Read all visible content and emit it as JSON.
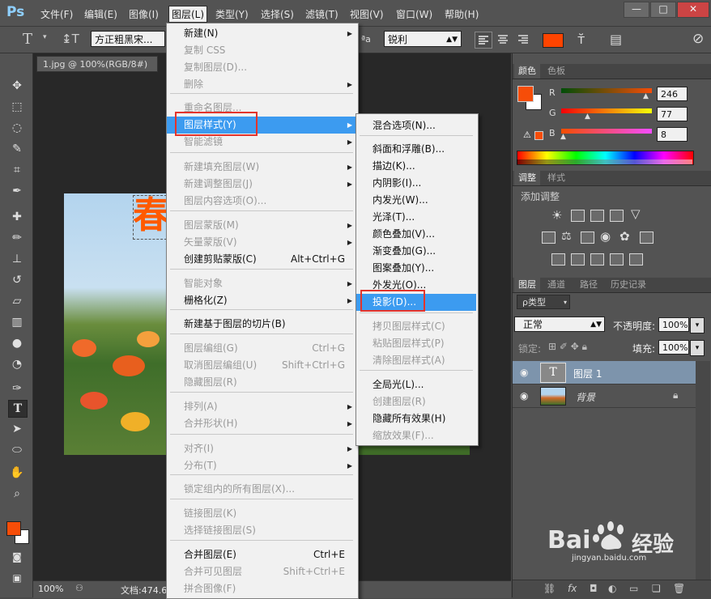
{
  "app": {
    "logo": "Ps",
    "menubar": [
      "文件(F)",
      "编辑(E)",
      "图像(I)",
      "图层(L)",
      "类型(Y)",
      "选择(S)",
      "滤镜(T)",
      "视图(V)",
      "窗口(W)",
      "帮助(H)"
    ],
    "window_buttons": [
      "—",
      "□",
      "✕"
    ]
  },
  "optbar": {
    "tool_icon": "T",
    "font_family": "方正粗黑宋...",
    "aa_label": "ªa",
    "anti_alias": "锐利",
    "text_color": "#ff4400"
  },
  "document": {
    "tab_title": "1.jpg @ 100%(RGB/8#)",
    "canvas_text": "春",
    "zoom": "100%",
    "doc_info": "文档:474.6"
  },
  "layer_menu": {
    "items": [
      {
        "label": "新建(N)",
        "shortcut": "",
        "submenu": true,
        "disabled": false
      },
      {
        "label": "复制 CSS",
        "shortcut": "",
        "submenu": false,
        "disabled": true
      },
      {
        "label": "复制图层(D)...",
        "shortcut": "",
        "submenu": false,
        "disabled": true
      },
      {
        "label": "删除",
        "shortcut": "",
        "submenu": true,
        "disabled": true
      },
      {
        "label": "重命名图层...",
        "shortcut": "",
        "submenu": false,
        "disabled": true
      },
      {
        "label": "图层样式(Y)",
        "shortcut": "",
        "submenu": true,
        "disabled": false,
        "highlighted": true
      },
      {
        "label": "智能滤镜",
        "shortcut": "",
        "submenu": true,
        "disabled": true
      },
      {
        "label": "新建填充图层(W)",
        "shortcut": "",
        "submenu": true,
        "disabled": true
      },
      {
        "label": "新建调整图层(J)",
        "shortcut": "",
        "submenu": true,
        "disabled": true
      },
      {
        "label": "图层内容选项(O)...",
        "shortcut": "",
        "submenu": false,
        "disabled": true
      },
      {
        "label": "图层蒙版(M)",
        "shortcut": "",
        "submenu": true,
        "disabled": true
      },
      {
        "label": "矢量蒙版(V)",
        "shortcut": "",
        "submenu": true,
        "disabled": true
      },
      {
        "label": "创建剪贴蒙版(C)",
        "shortcut": "Alt+Ctrl+G",
        "submenu": false,
        "disabled": false
      },
      {
        "label": "智能对象",
        "shortcut": "",
        "submenu": true,
        "disabled": true
      },
      {
        "label": "栅格化(Z)",
        "shortcut": "",
        "submenu": true,
        "disabled": false
      },
      {
        "label": "新建基于图层的切片(B)",
        "shortcut": "",
        "submenu": false,
        "disabled": false
      },
      {
        "label": "图层编组(G)",
        "shortcut": "Ctrl+G",
        "submenu": false,
        "disabled": true
      },
      {
        "label": "取消图层编组(U)",
        "shortcut": "Shift+Ctrl+G",
        "submenu": false,
        "disabled": true
      },
      {
        "label": "隐藏图层(R)",
        "shortcut": "",
        "submenu": false,
        "disabled": true
      },
      {
        "label": "排列(A)",
        "shortcut": "",
        "submenu": true,
        "disabled": true
      },
      {
        "label": "合并形状(H)",
        "shortcut": "",
        "submenu": true,
        "disabled": true
      },
      {
        "label": "对齐(I)",
        "shortcut": "",
        "submenu": true,
        "disabled": true
      },
      {
        "label": "分布(T)",
        "shortcut": "",
        "submenu": true,
        "disabled": true
      },
      {
        "label": "锁定组内的所有图层(X)...",
        "shortcut": "",
        "submenu": false,
        "disabled": true
      },
      {
        "label": "链接图层(K)",
        "shortcut": "",
        "submenu": false,
        "disabled": true
      },
      {
        "label": "选择链接图层(S)",
        "shortcut": "",
        "submenu": false,
        "disabled": true
      },
      {
        "label": "合并图层(E)",
        "shortcut": "Ctrl+E",
        "submenu": false,
        "disabled": false
      },
      {
        "label": "合并可见图层",
        "shortcut": "Shift+Ctrl+E",
        "submenu": false,
        "disabled": true
      },
      {
        "label": "拼合图像(F)",
        "shortcut": "",
        "submenu": false,
        "disabled": true
      }
    ]
  },
  "style_menu": {
    "items": [
      {
        "label": "混合选项(N)...",
        "disabled": false
      },
      {
        "label": "斜面和浮雕(B)...",
        "disabled": false
      },
      {
        "label": "描边(K)...",
        "disabled": false
      },
      {
        "label": "内阴影(I)...",
        "disabled": false
      },
      {
        "label": "内发光(W)...",
        "disabled": false
      },
      {
        "label": "光泽(T)...",
        "disabled": false
      },
      {
        "label": "颜色叠加(V)...",
        "disabled": false
      },
      {
        "label": "渐变叠加(G)...",
        "disabled": false
      },
      {
        "label": "图案叠加(Y)...",
        "disabled": false
      },
      {
        "label": "外发光(O)...",
        "disabled": false
      },
      {
        "label": "投影(D)...",
        "disabled": false,
        "highlighted": true
      },
      {
        "label": "拷贝图层样式(C)",
        "disabled": true
      },
      {
        "label": "粘贴图层样式(P)",
        "disabled": true
      },
      {
        "label": "清除图层样式(A)",
        "disabled": true
      },
      {
        "label": "全局光(L)...",
        "disabled": false
      },
      {
        "label": "创建图层(R)",
        "disabled": true
      },
      {
        "label": "隐藏所有效果(H)",
        "disabled": false
      },
      {
        "label": "缩放效果(F)...",
        "disabled": true
      }
    ]
  },
  "color_panel": {
    "tabs": [
      "颜色",
      "色板"
    ],
    "r_label": "R",
    "g_label": "G",
    "b_label": "B",
    "r": "246",
    "g": "77",
    "b": "8",
    "foreground": "#f64d08",
    "background": "#ffffff"
  },
  "adjust_panel": {
    "tabs": [
      "调整",
      "样式"
    ],
    "title": "添加调整"
  },
  "layers_panel": {
    "tabs": [
      "图层",
      "通道",
      "路径",
      "历史记录"
    ],
    "filter_label": "ρ类型",
    "blend_mode": "正常",
    "opacity_label": "不透明度:",
    "opacity": "100%",
    "lock_label": "锁定:",
    "fill_label": "填充:",
    "fill": "100%",
    "layers": [
      {
        "name": "图层 1",
        "thumb": "T",
        "selected": true
      },
      {
        "name": "背景",
        "thumb": "",
        "selected": false,
        "locked": true
      }
    ]
  },
  "watermark": {
    "brand": "Bai",
    "brand2": "经验",
    "url": "jingyan.baidu.com"
  }
}
